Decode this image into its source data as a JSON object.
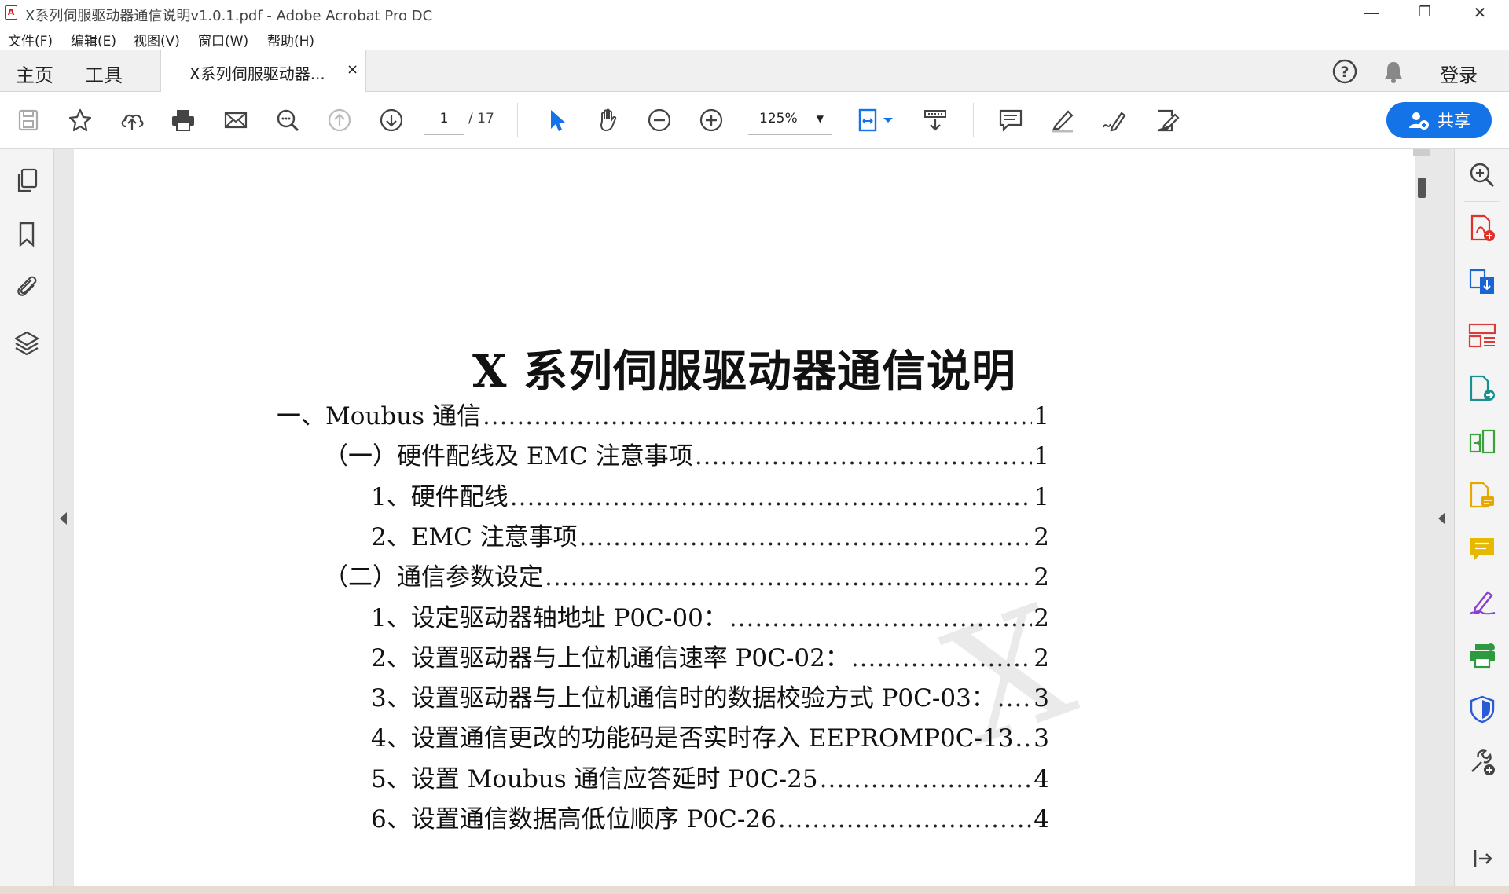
{
  "window": {
    "title": "X系列伺服驱动器通信说明v1.0.1.pdf - Adobe Acrobat Pro DC",
    "minimize": "—",
    "restore": "❐",
    "close": "✕"
  },
  "menu": [
    "文件(F)",
    "编辑(E)",
    "视图(V)",
    "窗口(W)",
    "帮助(H)"
  ],
  "tabs": {
    "home": "主页",
    "tools": "工具",
    "document": "X系列伺服驱动器...",
    "close": "×",
    "login": "登录"
  },
  "toolbar": {
    "page_current": "1",
    "page_total": "/ 17",
    "zoom": "125%",
    "share": "共享"
  },
  "icons": {
    "toolbar": [
      "save-icon",
      "bookmark-star-icon",
      "upload-cloud-icon",
      "print-icon",
      "email-icon",
      "find-icon",
      "page-up-icon",
      "page-down-icon",
      "select-cursor-icon",
      "hand-icon",
      "zoom-out-icon",
      "zoom-in-icon",
      "fit-page-icon",
      "scroll-mode-icon",
      "comment-icon",
      "highlight-icon",
      "sign-icon",
      "edit-icon"
    ],
    "left": [
      "pages-icon",
      "bookmarks-icon",
      "attachments-icon",
      "layers-icon"
    ],
    "right": [
      "search-tool-icon",
      "create-pdf-icon",
      "export-pdf-icon",
      "organize-pages-icon",
      "send-file-icon",
      "combine-icon",
      "edit-pdf-icon",
      "comment-tool-icon",
      "fill-sign-icon",
      "print-production-icon",
      "protect-icon",
      "more-tools-icon",
      "collapse-panel-icon"
    ]
  },
  "colors": {
    "accent": "#1473e6",
    "icon_gray": "#555555",
    "create_red": "#e0302a",
    "export_blue": "#1a64d4",
    "organize_red": "#d93a3a",
    "send_teal": "#1a8f8f",
    "combine_green": "#3ca03c",
    "edit_yellow": "#e6a800",
    "comment_yellow": "#e6b800",
    "sign_purple": "#8a3fd1",
    "print_green": "#2e9a3e",
    "protect_blue": "#2a5bd7"
  },
  "document": {
    "title": "X 系列伺服驱动器通信说明",
    "toc": [
      {
        "text": "一、Moubus 通信",
        "page": "1",
        "level": 0
      },
      {
        "text": "（一）硬件配线及 EMC 注意事项",
        "page": "1",
        "level": 1
      },
      {
        "text": "1、硬件配线",
        "page": "1",
        "level": 2
      },
      {
        "text": "2、EMC 注意事项",
        "page": "2",
        "level": 2
      },
      {
        "text": "（二）通信参数设定",
        "page": "2",
        "level": 1
      },
      {
        "text": "1、设定驱动器轴地址 P0C-00：",
        "page": "2",
        "level": 2
      },
      {
        "text": "2、设置驱动器与上位机通信速率 P0C-02：",
        "page": "2",
        "level": 2
      },
      {
        "text": "3、设置驱动器与上位机通信时的数据校验方式 P0C-03：",
        "page": "3",
        "level": 2
      },
      {
        "text": "4、设置通信更改的功能码是否实时存入 EEPROMP0C-13",
        "page": "3",
        "level": 2
      },
      {
        "text": "5、设置 Moubus 通信应答延时 P0C-25",
        "page": "4",
        "level": 2
      },
      {
        "text": "6、设置通信数据高低位顺序 P0C-26",
        "page": "4",
        "level": 2
      }
    ]
  }
}
